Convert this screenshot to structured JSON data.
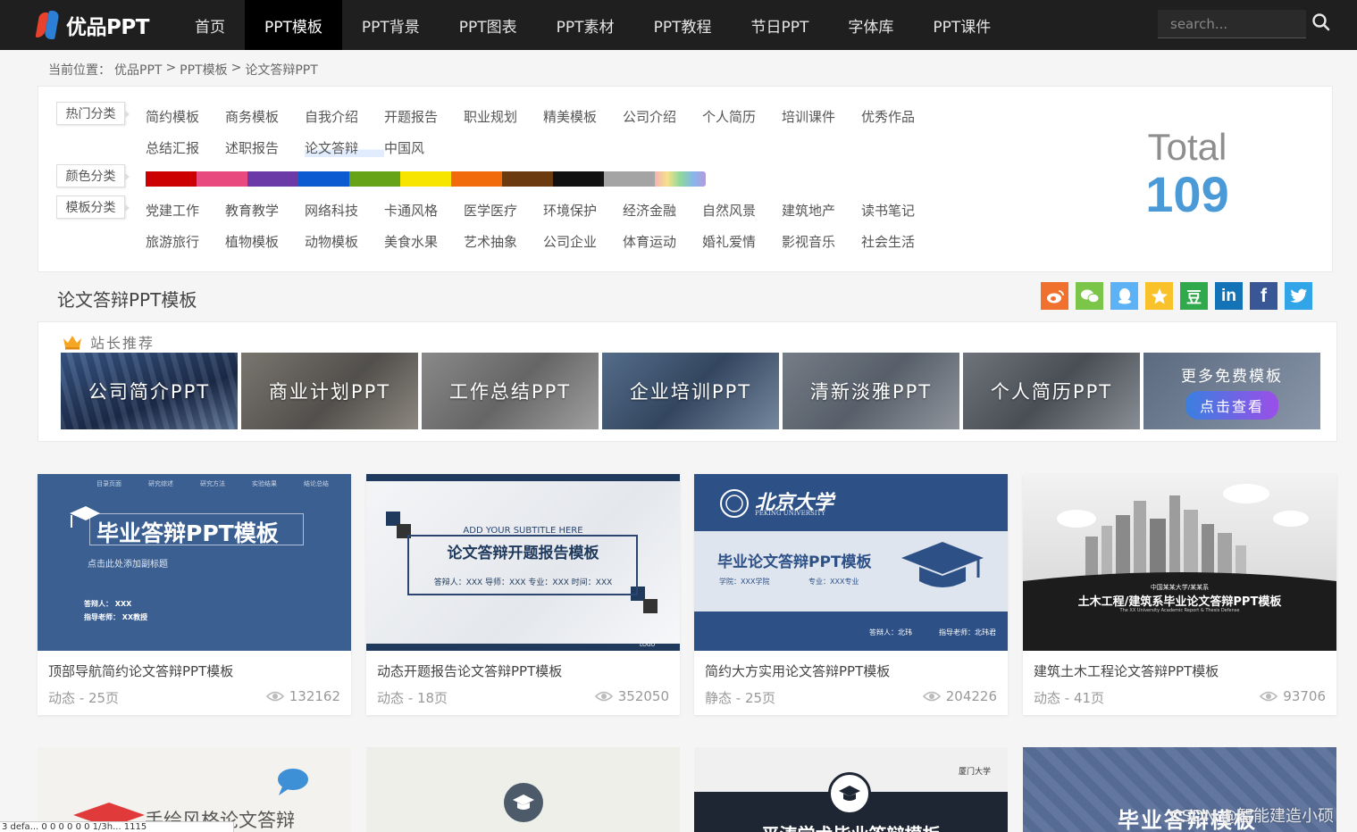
{
  "nav": {
    "logo_text": "优品PPT",
    "items": [
      "首页",
      "PPT模板",
      "PPT背景",
      "PPT图表",
      "PPT素材",
      "PPT教程",
      "节日PPT",
      "字体库",
      "PPT课件"
    ],
    "active_index": 1,
    "search_placeholder": "search..."
  },
  "breadcrumb": {
    "prefix": "当前位置：",
    "items": [
      "优品PPT",
      "PPT模板",
      "论文答辩PPT"
    ],
    "separator": ">"
  },
  "categories": {
    "hot_label": "热门分类",
    "hot_row1": [
      "简约模板",
      "商务模板",
      "自我介绍",
      "开题报告",
      "职业规划",
      "精美模板",
      "公司介绍",
      "个人简历",
      "培训课件",
      "优秀作品"
    ],
    "hot_row2": [
      "总结汇报",
      "述职报告",
      "论文答辩",
      "中国风"
    ],
    "current_item": "论文答辩",
    "color_label": "颜色分类",
    "colors": [
      "#cc0000",
      "#e84a7f",
      "#6c3aa6",
      "#0d5bd1",
      "#67a316",
      "#f7e500",
      "#f16a0b",
      "#6b3b0f",
      "#111111",
      "#a4a4a4",
      "rainbow"
    ],
    "template_label": "模板分类",
    "tpl_row1": [
      "党建工作",
      "教育教学",
      "网络科技",
      "卡通风格",
      "医学医疗",
      "环境保护",
      "经济金融",
      "自然风景",
      "建筑地产",
      "读书笔记"
    ],
    "tpl_row2": [
      "旅游旅行",
      "植物模板",
      "动物模板",
      "美食水果",
      "艺术抽象",
      "公司企业",
      "体育运动",
      "婚礼爱情",
      "影视音乐",
      "社会生活"
    ]
  },
  "total": {
    "label": "Total",
    "value": "109"
  },
  "section_title": "论文答辩PPT模板",
  "share": [
    {
      "name": "weibo",
      "glyph": "微",
      "color": "#f0712d"
    },
    {
      "name": "wechat",
      "glyph": "◎",
      "color": "#7bc549"
    },
    {
      "name": "qq",
      "glyph": "♟",
      "color": "#5cb2f4"
    },
    {
      "name": "qzone",
      "glyph": "★",
      "color": "#f9c22b"
    },
    {
      "name": "douban",
      "glyph": "豆",
      "color": "#2fa94c"
    },
    {
      "name": "linkedin",
      "glyph": "in",
      "color": "#1473b7"
    },
    {
      "name": "facebook",
      "glyph": "f",
      "color": "#3a5795"
    },
    {
      "name": "twitter",
      "glyph": "t",
      "color": "#32a4e8"
    }
  ],
  "recommend": {
    "heading": "站长推荐",
    "tiles": [
      "公司简介PPT",
      "商业计划PPT",
      "工作总结PPT",
      "企业培训PPT",
      "清新淡雅PPT",
      "个人简历PPT"
    ],
    "more_text": "更多免费模板",
    "more_button": "点击查看"
  },
  "cards": [
    {
      "title": "顶部导航简约论文答辩PPT模板",
      "meta": "动态 - 25页",
      "views": "132162",
      "thumb": {
        "heading": "毕业答辩PPT模板",
        "sub": "点击此处添加副标题",
        "lines": [
          "答辩人：   XXX",
          "指导老师：  XX教授"
        ],
        "tabs": [
          "目录页面",
          "研究综述",
          "研究方法",
          "实验结果",
          "结论总结"
        ]
      }
    },
    {
      "title": "动态开题报告论文答辩PPT模板",
      "meta": "动态 - 18页",
      "views": "352050",
      "thumb": {
        "sub": "ADD YOUR SUBTITLE HERE",
        "heading": "论文答辩开题报告模板",
        "line": "答辩人：XXX  导师：XXX  专业：XXX  时间：XXX",
        "logo": "LOGO"
      }
    },
    {
      "title": "简约大方实用论文答辩PPT模板",
      "meta": "静态 - 25页",
      "views": "204226",
      "thumb": {
        "school": "北京大学",
        "school_en": "PEKING UNIVERSITY",
        "heading": "毕业论文答辩PPT模板",
        "line1": "学院：XXX学院",
        "line2": "专业：XXX专业",
        "line3": "答辩人：北玮",
        "line4": "指导老师：北玮君"
      }
    },
    {
      "title": "建筑土木工程论文答辩PPT模板",
      "meta": "动态 - 41页",
      "views": "93706",
      "thumb": {
        "school": "中国某某大学/某某系",
        "heading": "土木工程/建筑系毕业论文答辩PPT模板",
        "line": "The XX University Academic Report & Thesis Defense"
      }
    }
  ],
  "cards_row2": [
    {
      "heading": "手绘风格论文答辩"
    },
    {
      "heading": ""
    },
    {
      "heading": "平涛学术毕业答辩模板",
      "school": "厦门大学"
    },
    {
      "heading": "毕业答辩模板"
    }
  ],
  "watermark": "CSDN @智能建造小硕",
  "status_bar": "3 defa... 0 0 0 0 0 0 1/3h... 1115"
}
